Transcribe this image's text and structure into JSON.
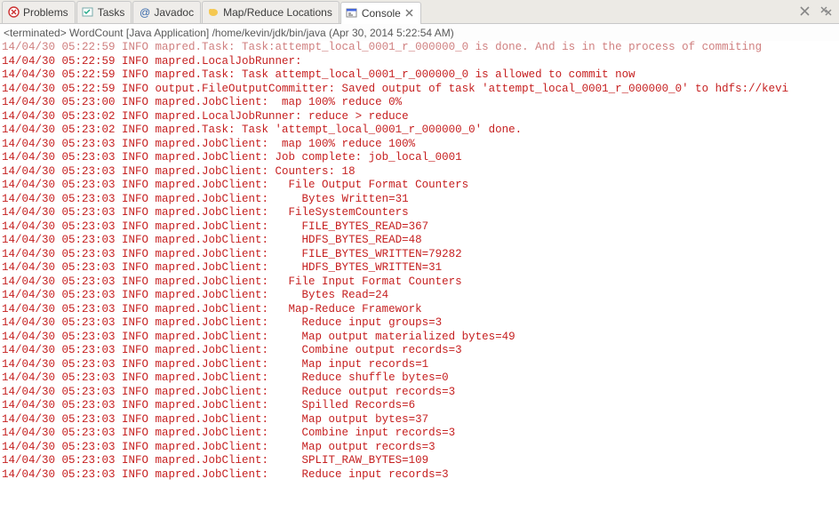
{
  "tabs": {
    "problems": "Problems",
    "tasks": "Tasks",
    "javadoc": "Javadoc",
    "mapreduce": "Map/Reduce Locations",
    "console": "Console"
  },
  "status": "<terminated> WordCount [Java Application] /home/kevin/jdk/bin/java (Apr 30, 2014 5:22:54 AM)",
  "lines": [
    "14/04/30 05:22:59 INFO mapred.Task: Task:attempt_local_0001_r_000000_0 is done. And is in the process of commiting",
    "14/04/30 05:22:59 INFO mapred.LocalJobRunner:",
    "14/04/30 05:22:59 INFO mapred.Task: Task attempt_local_0001_r_000000_0 is allowed to commit now",
    "14/04/30 05:22:59 INFO output.FileOutputCommitter: Saved output of task 'attempt_local_0001_r_000000_0' to hdfs://kevi",
    "14/04/30 05:23:00 INFO mapred.JobClient:  map 100% reduce 0%",
    "14/04/30 05:23:02 INFO mapred.LocalJobRunner: reduce > reduce",
    "14/04/30 05:23:02 INFO mapred.Task: Task 'attempt_local_0001_r_000000_0' done.",
    "14/04/30 05:23:03 INFO mapred.JobClient:  map 100% reduce 100%",
    "14/04/30 05:23:03 INFO mapred.JobClient: Job complete: job_local_0001",
    "14/04/30 05:23:03 INFO mapred.JobClient: Counters: 18",
    "14/04/30 05:23:03 INFO mapred.JobClient:   File Output Format Counters ",
    "14/04/30 05:23:03 INFO mapred.JobClient:     Bytes Written=31",
    "14/04/30 05:23:03 INFO mapred.JobClient:   FileSystemCounters",
    "14/04/30 05:23:03 INFO mapred.JobClient:     FILE_BYTES_READ=367",
    "14/04/30 05:23:03 INFO mapred.JobClient:     HDFS_BYTES_READ=48",
    "14/04/30 05:23:03 INFO mapred.JobClient:     FILE_BYTES_WRITTEN=79282",
    "14/04/30 05:23:03 INFO mapred.JobClient:     HDFS_BYTES_WRITTEN=31",
    "14/04/30 05:23:03 INFO mapred.JobClient:   File Input Format Counters ",
    "14/04/30 05:23:03 INFO mapred.JobClient:     Bytes Read=24",
    "14/04/30 05:23:03 INFO mapred.JobClient:   Map-Reduce Framework",
    "14/04/30 05:23:03 INFO mapred.JobClient:     Reduce input groups=3",
    "14/04/30 05:23:03 INFO mapred.JobClient:     Map output materialized bytes=49",
    "14/04/30 05:23:03 INFO mapred.JobClient:     Combine output records=3",
    "14/04/30 05:23:03 INFO mapred.JobClient:     Map input records=1",
    "14/04/30 05:23:03 INFO mapred.JobClient:     Reduce shuffle bytes=0",
    "14/04/30 05:23:03 INFO mapred.JobClient:     Reduce output records=3",
    "14/04/30 05:23:03 INFO mapred.JobClient:     Spilled Records=6",
    "14/04/30 05:23:03 INFO mapred.JobClient:     Map output bytes=37",
    "14/04/30 05:23:03 INFO mapred.JobClient:     Combine input records=3",
    "14/04/30 05:23:03 INFO mapred.JobClient:     Map output records=3",
    "14/04/30 05:23:03 INFO mapred.JobClient:     SPLIT_RAW_BYTES=109",
    "14/04/30 05:23:03 INFO mapred.JobClient:     Reduce input records=3"
  ]
}
